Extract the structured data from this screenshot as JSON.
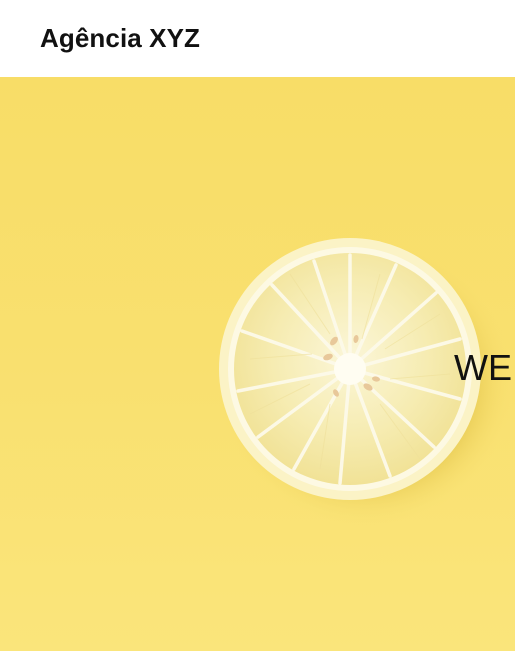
{
  "header": {
    "brand": "Agência XYZ"
  },
  "hero": {
    "image": "lemon-slice-on-yellow-background",
    "heading": "WE"
  },
  "colors": {
    "header_bg": "#ffffff",
    "hero_bg": "#f9e06f",
    "text": "#111111"
  }
}
